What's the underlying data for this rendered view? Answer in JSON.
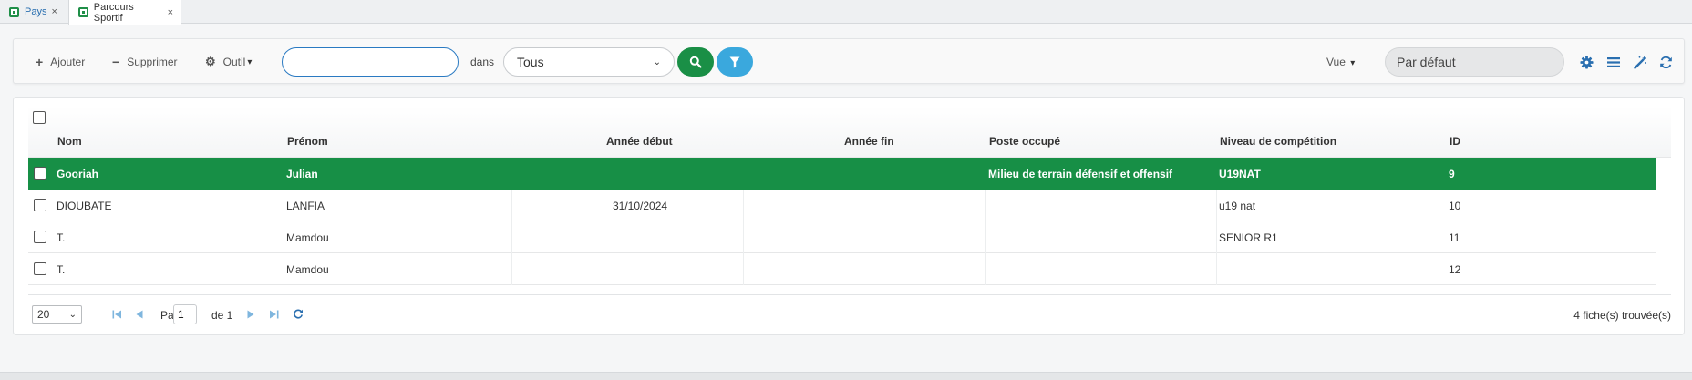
{
  "tabs": [
    {
      "label": "Pays",
      "close": "×"
    },
    {
      "label": "Parcours Sportif",
      "close": "×"
    }
  ],
  "toolbar": {
    "add_label": "Ajouter",
    "delete_label": "Supprimer",
    "tools_label": "Outil",
    "search_value": "",
    "in_label": "dans",
    "scope_selected": "Tous",
    "view_label": "Vue",
    "view_selected": "Par défaut"
  },
  "colors": {
    "accent_green": "#178f46",
    "accent_blue": "#3aa8dd",
    "link_blue": "#2a6fb0"
  },
  "icons": {
    "add": "plus-icon",
    "delete": "minus-icon",
    "tools": "gear-icon",
    "search": "search-icon",
    "filter": "filter-icon",
    "settings": "gear-icon",
    "columns": "list-icon",
    "wizard": "magic-wand-icon",
    "refresh": "refresh-icon"
  },
  "grid": {
    "columns": [
      "Nom",
      "Prénom",
      "Année début",
      "Année fin",
      "Poste occupé",
      "Niveau de compétition",
      "ID"
    ],
    "rows": [
      {
        "nom": "Gooriah",
        "prenom": "Julian",
        "debut": "",
        "fin": "",
        "poste": "Milieu de terrain défensif et offensif",
        "niveau": "U19NAT",
        "id": "9",
        "selected": true
      },
      {
        "nom": "DIOUBATE",
        "prenom": "LANFIA",
        "debut": "31/10/2024",
        "fin": "",
        "poste": "",
        "niveau": "u19 nat",
        "id": "10",
        "selected": false
      },
      {
        "nom": "T.",
        "prenom": "Mamdou",
        "debut": "",
        "fin": "",
        "poste": "",
        "niveau": "SENIOR R1",
        "id": "11",
        "selected": false
      },
      {
        "nom": "T.",
        "prenom": "Mamdou",
        "debut": "",
        "fin": "",
        "poste": "",
        "niveau": "",
        "id": "12",
        "selected": false
      }
    ]
  },
  "pager": {
    "page_size": "20",
    "page_label": "Page",
    "page_value": "1",
    "of_label": "de 1",
    "count_text": "4 fiche(s) trouvée(s)"
  }
}
